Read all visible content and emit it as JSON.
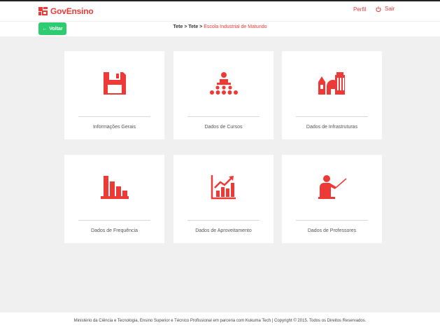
{
  "header": {
    "logo_text": "GovEnsino",
    "perfil_label": "Perfil",
    "sair_label": "Sair"
  },
  "subbar": {
    "back_label": "Voltar",
    "breadcrumb": [
      "Tete",
      "Tete",
      "Escola Industrial de Matundo"
    ],
    "separator": " > "
  },
  "cards": [
    {
      "label": "Informações Gerais",
      "icon": "floppy-disk-icon"
    },
    {
      "label": "Dados de Cursos",
      "icon": "classroom-icon"
    },
    {
      "label": "Dados de Infrastruturas",
      "icon": "buildings-icon"
    },
    {
      "label": "Dados de Frequência",
      "icon": "bar-chart-descending-icon"
    },
    {
      "label": "Dados de Aproveitamento",
      "icon": "growth-chart-icon"
    },
    {
      "label": "Dados de Professores",
      "icon": "teacher-icon"
    }
  ],
  "footer": {
    "text": "Ministério da Ciência e Tecnologia, Ensino Superior e Técnico Profissional em parceria com Kukuma Tech | Copyright © 2015. Todos os Direitos Reservados."
  },
  "colors": {
    "accent": "#ee3a36",
    "back_button": "#2ecc71",
    "background": "#f0f0f0"
  }
}
